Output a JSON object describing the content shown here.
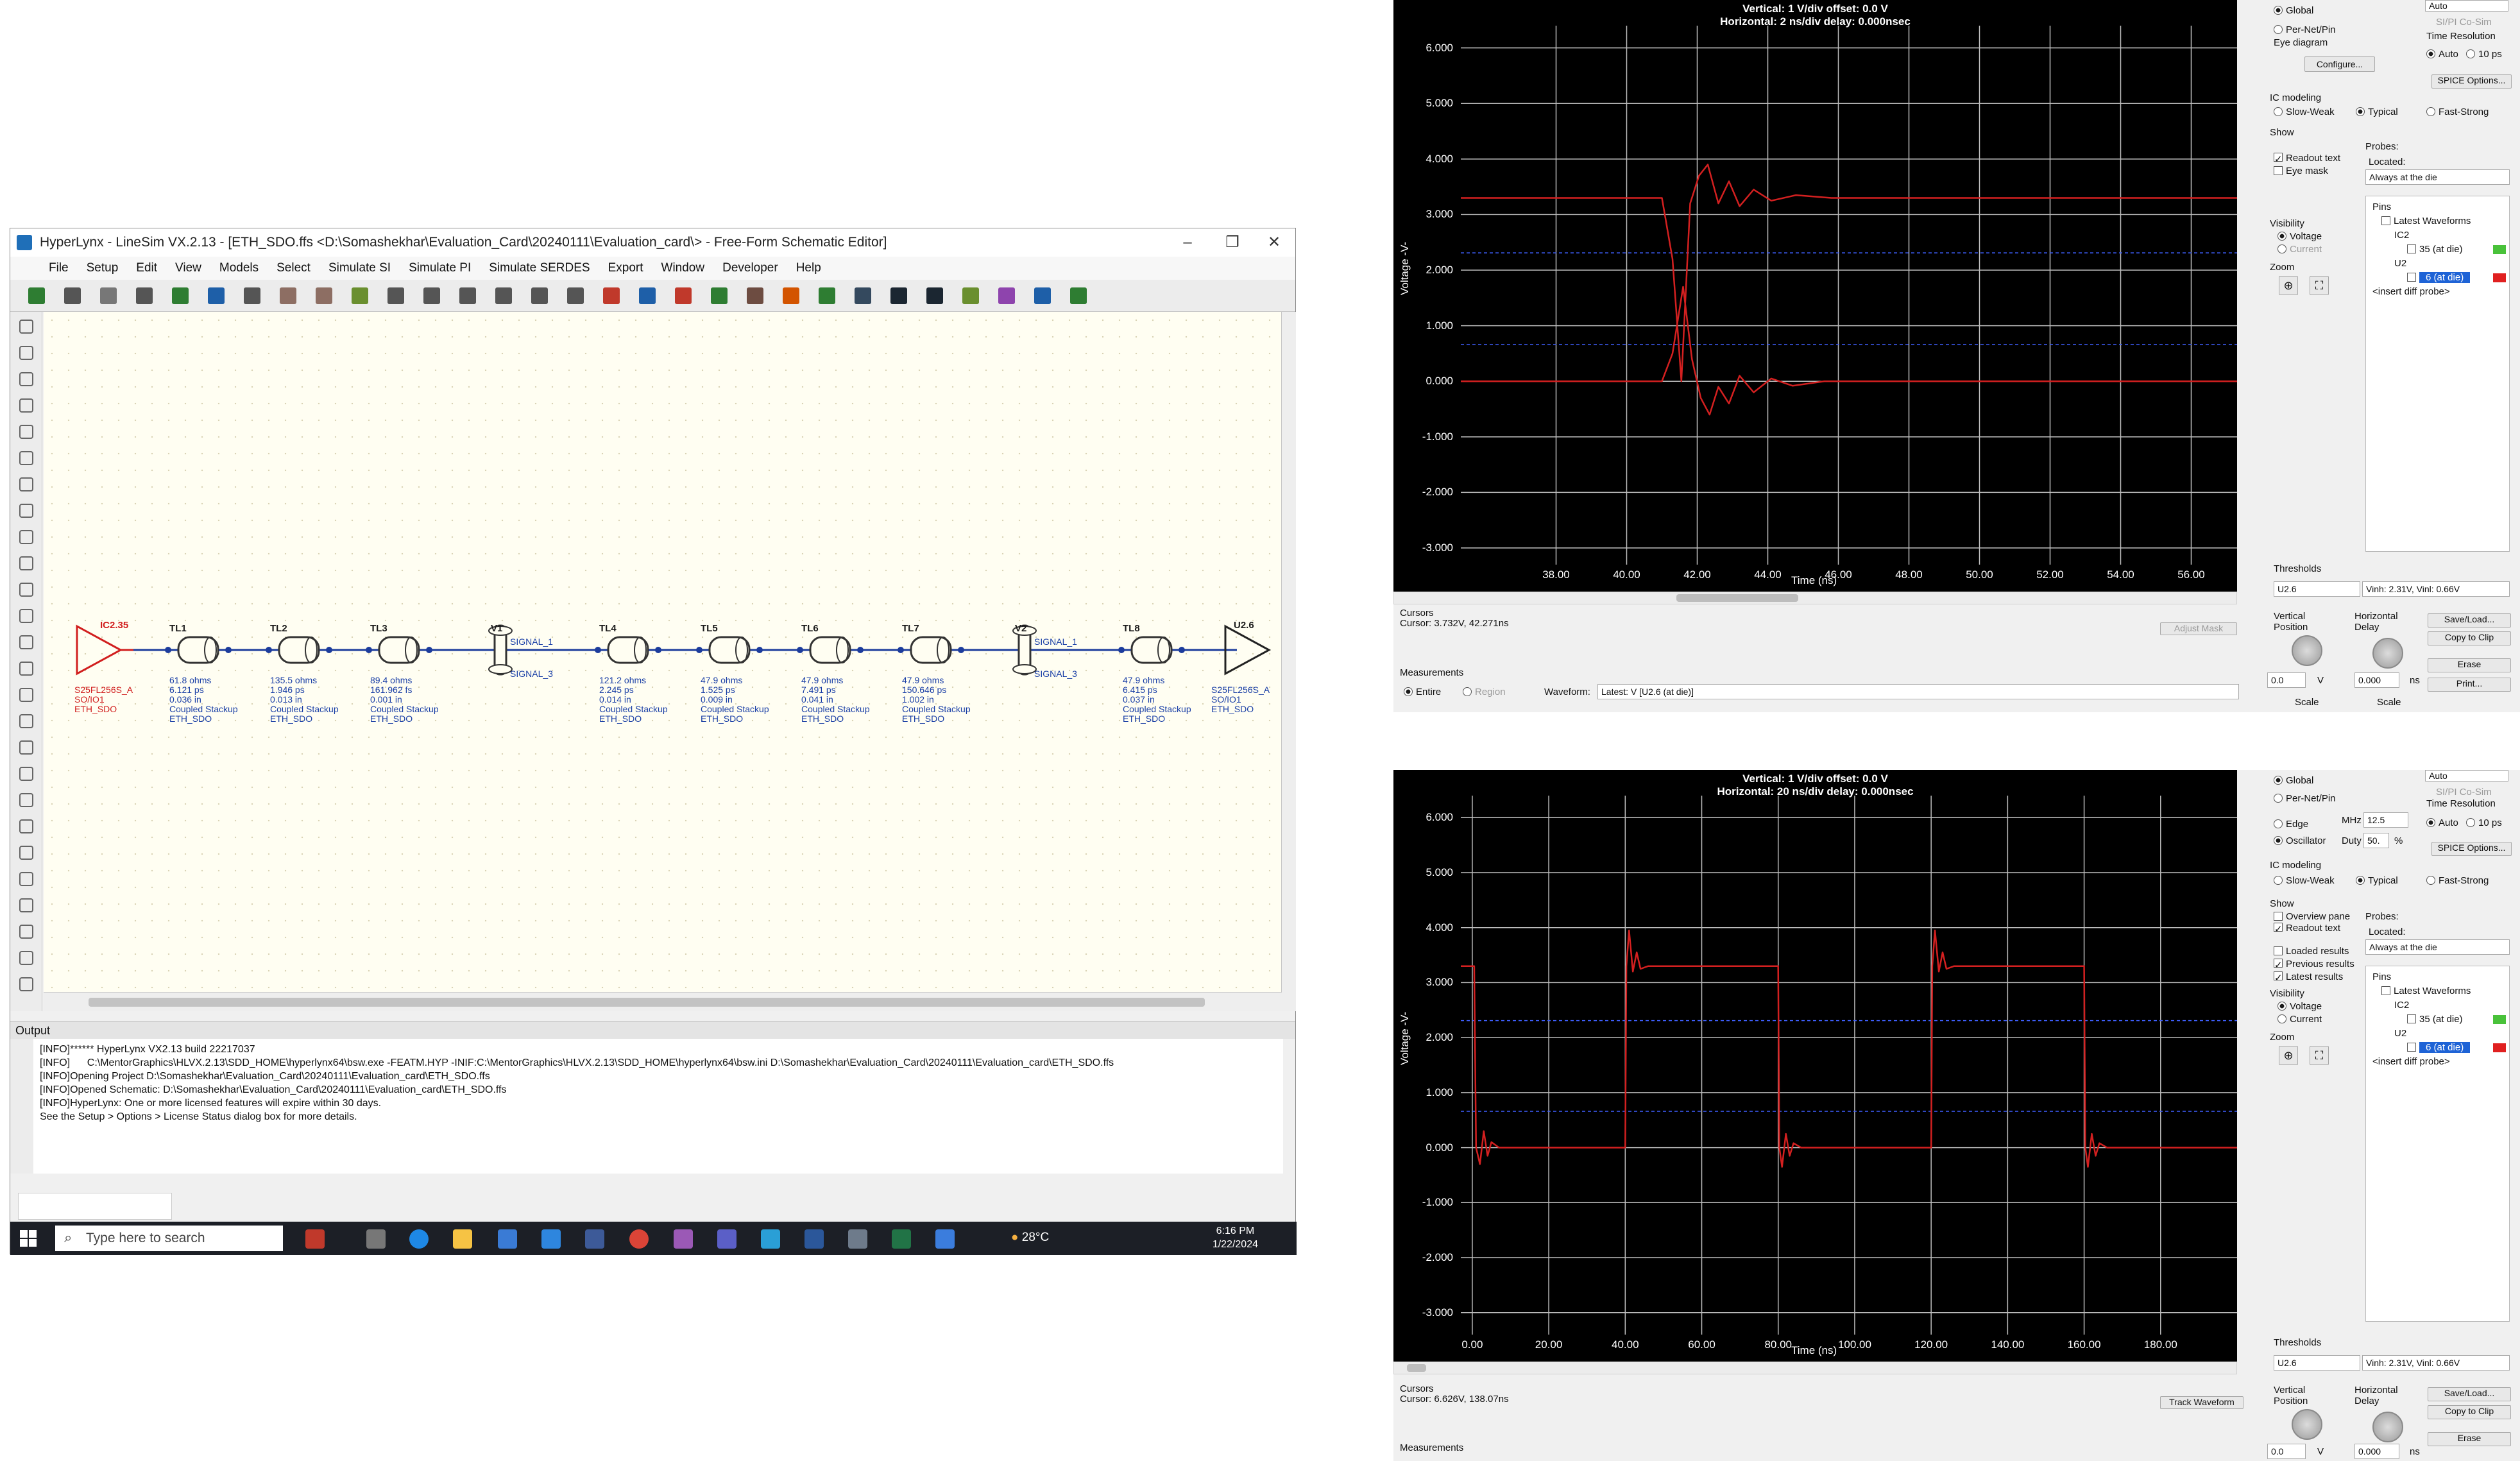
{
  "hyperlynx": {
    "title": "HyperLynx - LineSim VX.2.13 - [ETH_SDO.ffs <D:\\Somashekhar\\Evaluation_Card\\20240111\\Evaluation_card\\> - Free-Form Schematic Editor]",
    "menu": [
      "File",
      "Setup",
      "Edit",
      "View",
      "Models",
      "Select",
      "Simulate SI",
      "Simulate PI",
      "Simulate SERDES",
      "Export",
      "Window",
      "Developer",
      "Help"
    ],
    "schematic": {
      "driver": {
        "name": "IC2.35",
        "lines": [
          "S25FL256S_A",
          "SO/IO1",
          "ETH_SDO"
        ]
      },
      "receiver": {
        "name": "U2.6",
        "lines": [
          "S25FL256S_A",
          "SO/IO1",
          "ETH_SDO"
        ]
      },
      "lines": [
        {
          "name": "TL1",
          "lines": [
            "61.8 ohms",
            "6.121 ps",
            "0.036 in",
            "Coupled Stackup",
            "ETH_SDO"
          ]
        },
        {
          "name": "TL2",
          "lines": [
            "135.5 ohms",
            "1.946 ps",
            "0.013 in",
            "Coupled Stackup",
            "ETH_SDO"
          ]
        },
        {
          "name": "TL3",
          "lines": [
            "89.4 ohms",
            "161.962 fs",
            "0.001 in",
            "Coupled Stackup",
            "ETH_SDO"
          ]
        },
        {
          "name": "TL4",
          "lines": [
            "121.2 ohms",
            "2.245 ps",
            "0.014 in",
            "Coupled Stackup",
            "ETH_SDO"
          ]
        },
        {
          "name": "TL5",
          "lines": [
            "47.9 ohms",
            "1.525 ps",
            "0.009 in",
            "Coupled Stackup",
            "ETH_SDO"
          ]
        },
        {
          "name": "TL6",
          "lines": [
            "47.9 ohms",
            "7.491 ps",
            "0.041 in",
            "Coupled Stackup",
            "ETH_SDO"
          ]
        },
        {
          "name": "TL7",
          "lines": [
            "47.9 ohms",
            "150.646 ps",
            "1.002 in",
            "Coupled Stackup",
            "ETH_SDO"
          ]
        },
        {
          "name": "TL8",
          "lines": [
            "47.9 ohms",
            "6.415 ps",
            "0.037 in",
            "Coupled Stackup",
            "ETH_SDO"
          ]
        }
      ],
      "vias": [
        {
          "name": "V1",
          "top": "SIGNAL_1",
          "bottom": "SIGNAL_3"
        },
        {
          "name": "V2",
          "top": "SIGNAL_1",
          "bottom": "SIGNAL_3"
        }
      ]
    },
    "output": {
      "label": "Output",
      "lines": [
        "[INFO]****** HyperLynx VX2.13 build 22217037",
        "[INFO]      C:\\MentorGraphics\\HLVX.2.13\\SDD_HOME\\hyperlynx64\\bsw.exe -FEATM.HYP -INIF:C:\\MentorGraphics\\HLVX.2.13\\SDD_HOME\\hyperlynx64\\bsw.ini D:\\Somashekhar\\Evaluation_Card\\20240111\\Evaluation_card\\ETH_SDO.ffs",
        "[INFO]Opening Project D:\\Somashekhar\\Evaluation_Card\\20240111\\Evaluation_card\\ETH_SDO.ffs",
        "[INFO]Opened Schematic: D:\\Somashekhar\\Evaluation_Card\\20240111\\Evaluation_card\\ETH_SDO.ffs",
        "[INFO]HyperLynx: One or more licensed features will expire within 30 days.",
        "See the Setup > Options > License Status dialog box for more details."
      ]
    },
    "taskbar": {
      "search": "Type here to search",
      "temp": "28°C",
      "time": "6:16 PM",
      "date": "1/22/2024"
    }
  },
  "scope_top": {
    "header_v": "Vertical: 1  V/div  offset: 0.0 V",
    "header_h": "Horizontal: 2 ns/div  delay: 0.000nsec",
    "ylabel": "Voltage  -V-",
    "xlabel": "Time  (ns)",
    "cursor_label": "Cursors",
    "cursor": "Cursor: 3.732V, 42.271ns",
    "adjust_mask": "Adjust Mask",
    "measurements": "Measurements",
    "meas_entire": "Entire",
    "meas_region": "Region",
    "waveform_label": "Waveform:",
    "waveform_value": "Latest: V [U2.6 (at die)]",
    "side": {
      "global": "Global",
      "pernet": "Per-Net/Pin",
      "eye": "Eye diagram",
      "configure": "Configure...",
      "auto": "Auto",
      "sipi": "SI/PI Co-Sim",
      "timeres": "Time Resolution",
      "auto2": "Auto",
      "res_val": "10",
      "res_unit": "ps",
      "spice": "SPICE Options...",
      "icmodel": "IC modeling",
      "slow": "Slow-Weak",
      "typ": "Typical",
      "fast": "Fast-Strong",
      "show": "Show",
      "probes": "Probes:",
      "readout": "Readout text",
      "eyemask": "Eye mask",
      "located": "Located:",
      "located_val": "Always at the die",
      "pins": "Pins",
      "latest": "Latest Waveforms",
      "ic2": "IC2",
      "pin35": "35 (at die)",
      "u2": "U2",
      "pin6": "6 (at die)",
      "diff": "<insert diff probe>",
      "visibility": "Visibility",
      "voltage": "Voltage",
      "current": "Current",
      "zoom": "Zoom",
      "thresholds": "Thresholds",
      "thr_sel": "U2.6",
      "thr_val": "Vinh: 2.31V, Vinl: 0.66V",
      "vpos": "Vertical Position",
      "hdelay": "Horizontal Delay",
      "vpos_val": "0.0",
      "vpos_unit": "V",
      "hdelay_val": "0.000",
      "hdelay_unit": "ns",
      "scale": "Scale",
      "scale2": "Scale",
      "save": "Save/Load...",
      "copy": "Copy to Clip",
      "erase": "Erase",
      "print": "Print..."
    }
  },
  "scope_bottom": {
    "header_v": "Vertical: 1  V/div  offset: 0.0 V",
    "header_h": "Horizontal: 20 ns/div  delay: 0.000nsec",
    "ylabel": "Voltage  -V-",
    "xlabel": "Time  (ns)",
    "cursor_label": "Cursors",
    "cursor": "Cursor: 6.626V, 138.07ns",
    "track": "Track Waveform",
    "measurements": "Measurements",
    "side": {
      "global": "Global",
      "pernet": "Per-Net/Pin",
      "edge": "Edge",
      "osc": "Oscillator",
      "mhz": "MHz",
      "mhz_val": "12.5",
      "duty": "Duty",
      "duty_val": "50.",
      "pct": "%",
      "auto": "Auto",
      "sipi": "SI/PI Co-Sim",
      "timeres": "Time Resolution",
      "auto2": "Auto",
      "res_val": "10",
      "res_unit": "ps",
      "spice": "SPICE Options...",
      "icmodel": "IC modeling",
      "slow": "Slow-Weak",
      "typ": "Typical",
      "fast": "Fast-Strong",
      "show": "Show",
      "overview": "Overview pane",
      "readout": "Readout text",
      "probes": "Probes:",
      "located": "Located:",
      "located_val": "Always at the die",
      "loaded": "Loaded results",
      "previous": "Previous results",
      "latest_r": "Latest results",
      "pins": "Pins",
      "latest": "Latest Waveforms",
      "ic2": "IC2",
      "pin35": "35 (at die)",
      "u2": "U2",
      "pin6": "6 (at die)",
      "diff": "<insert diff probe>",
      "visibility": "Visibility",
      "voltage": "Voltage",
      "current": "Current",
      "zoom": "Zoom",
      "thresholds": "Thresholds",
      "thr_sel": "U2.6",
      "thr_val": "Vinh: 2.31V, Vinl: 0.66V",
      "vpos": "Vertical Position",
      "hdelay": "Horizontal Delay",
      "vpos_val": "0.0",
      "vpos_unit": "V",
      "hdelay_val": "0.000",
      "hdelay_unit": "ns",
      "save": "Save/Load...",
      "copy": "Copy to Clip",
      "erase": "Erase"
    }
  },
  "chart_data": [
    {
      "type": "line",
      "xlabel": "Time (ns)",
      "ylabel": "Voltage -V-",
      "x_ticks": [
        38,
        40,
        42,
        44,
        46,
        48,
        50,
        52,
        54,
        56
      ],
      "y_ticks": [
        6,
        5,
        4,
        3,
        2,
        1,
        0,
        -1,
        -2,
        -3
      ],
      "xlim": [
        35.3,
        57.3
      ],
      "ylim": [
        -3.3,
        6.4
      ],
      "threshold_lines": [
        2.31,
        0.66
      ],
      "series": [
        {
          "color": "#d42020",
          "x": [
            35.3,
            41.0,
            41.3,
            41.55,
            41.8,
            42.05,
            42.3,
            42.6,
            42.9,
            43.2,
            43.6,
            44.1,
            44.8,
            45.8,
            57.3
          ],
          "y": [
            3.3,
            3.3,
            2.2,
            0.0,
            3.2,
            3.7,
            3.9,
            3.2,
            3.6,
            3.15,
            3.45,
            3.25,
            3.35,
            3.3,
            3.3
          ]
        },
        {
          "color": "#d42020",
          "x": [
            35.3,
            41.0,
            41.3,
            41.6,
            41.85,
            42.1,
            42.35,
            42.6,
            42.9,
            43.2,
            43.6,
            44.1,
            44.7,
            45.6,
            57.3
          ],
          "y": [
            0.0,
            0.0,
            0.5,
            1.7,
            0.4,
            -0.3,
            -0.6,
            -0.1,
            -0.4,
            0.1,
            -0.2,
            0.05,
            -0.08,
            0.0,
            0.0
          ]
        }
      ]
    },
    {
      "type": "line",
      "xlabel": "Time (ns)",
      "ylabel": "Voltage -V-",
      "x_ticks": [
        0,
        20,
        40,
        60,
        80,
        100,
        120,
        140,
        160,
        180
      ],
      "y_ticks": [
        6,
        5,
        4,
        3,
        2,
        1,
        0,
        -1,
        -2,
        -3
      ],
      "xlim": [
        -3,
        200
      ],
      "ylim": [
        -3.4,
        6.4
      ],
      "threshold_lines": [
        2.31,
        0.66
      ],
      "series": [
        {
          "color": "#d42020",
          "x": [
            -3,
            0.5,
            1.0,
            2,
            3,
            4,
            5,
            7,
            40,
            40.3,
            41,
            42,
            43,
            44,
            46,
            80,
            80.3,
            81,
            82,
            83,
            84,
            86,
            120,
            120.3,
            121,
            122,
            123,
            124,
            126,
            160,
            160.3,
            161,
            162,
            163,
            164,
            166,
            200
          ],
          "y": [
            3.3,
            3.3,
            0.0,
            -0.3,
            0.3,
            -0.15,
            0.1,
            0.0,
            0.0,
            3.3,
            3.95,
            3.2,
            3.55,
            3.25,
            3.3,
            3.3,
            0.0,
            -0.35,
            0.25,
            -0.15,
            0.08,
            0.0,
            0.0,
            3.3,
            3.95,
            3.2,
            3.55,
            3.25,
            3.3,
            3.3,
            0.0,
            -0.35,
            0.25,
            -0.15,
            0.08,
            0.0,
            0.0
          ]
        }
      ]
    }
  ]
}
